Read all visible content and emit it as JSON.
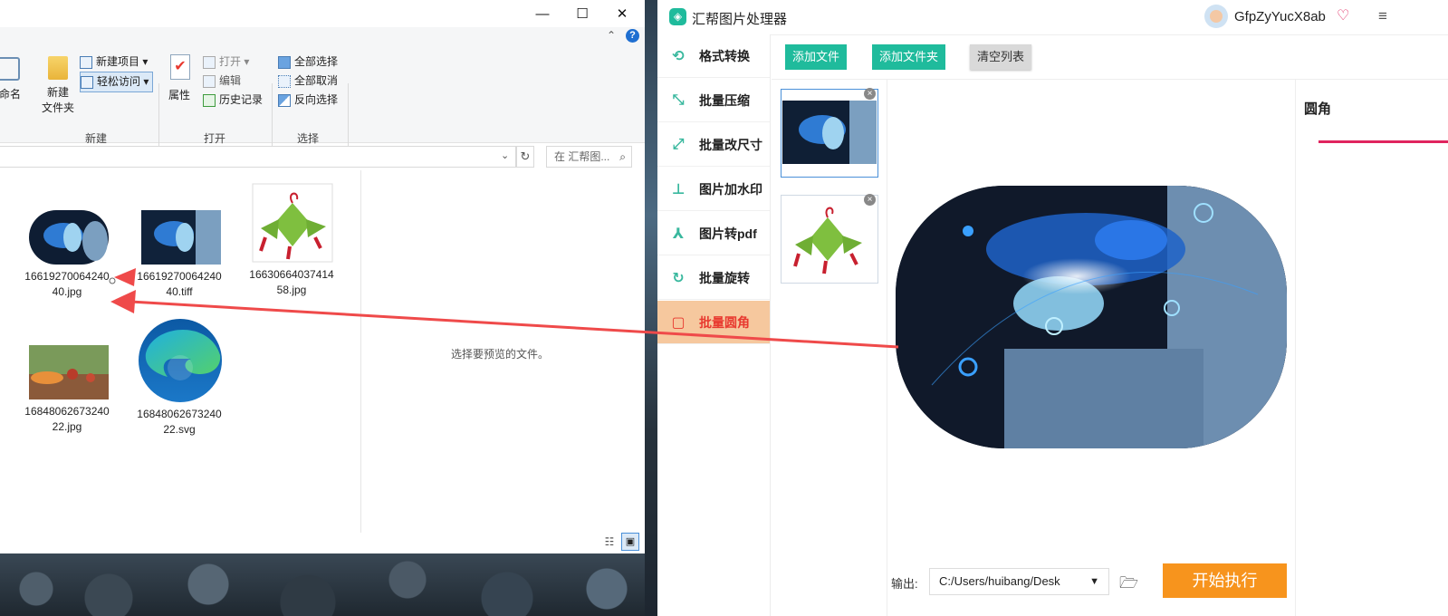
{
  "explorer": {
    "window_buttons": {
      "minimize": "—",
      "maximize": "☐",
      "close": "✕"
    },
    "ribbon": {
      "rename_partial": "重命名",
      "new_folder": "新建\n文件夹",
      "new_item": "新建项目",
      "easy_access": "轻松访问",
      "group_new": "新建",
      "properties": "属性",
      "open": "打开",
      "edit": "编辑",
      "history": "历史记录",
      "group_open": "打开",
      "select_all": "全部选择",
      "select_none": "全部取消",
      "invert_selection": "反向选择",
      "group_select": "选择"
    },
    "search_placeholder": "在 汇帮图...",
    "files": [
      {
        "name": "1661927006424040.jpg"
      },
      {
        "name": "1661927006424040.tiff"
      },
      {
        "name": "1663066403741458.jpg"
      },
      {
        "name": "1684806267324022.jpg"
      },
      {
        "name": "1684806267324022.svg"
      }
    ],
    "preview_hint": "选择要预览的文件。"
  },
  "app": {
    "title": "汇帮图片处理器",
    "username": "GfpZyYucX8ab",
    "nav": [
      {
        "label": "格式转换",
        "icon": "format-convert-icon"
      },
      {
        "label": "批量压缩",
        "icon": "compress-icon"
      },
      {
        "label": "批量改尺寸",
        "icon": "resize-icon"
      },
      {
        "label": "图片加水印",
        "icon": "watermark-icon"
      },
      {
        "label": "图片转pdf",
        "icon": "pdf-icon"
      },
      {
        "label": "批量旋转",
        "icon": "rotate-icon"
      },
      {
        "label": "批量圆角",
        "icon": "round-corner-icon",
        "active": true
      }
    ],
    "toolbar": {
      "add_file": "添加文件",
      "add_folder": "添加文件夹",
      "clear_list": "清空列表"
    },
    "settings": {
      "title": "圆角"
    },
    "output": {
      "label": "输出:",
      "path": "C:/Users/huibang/Desk"
    },
    "start_button": "开始执行",
    "colors": {
      "accent": "#1fbb9c",
      "active_nav_bg": "#f6c89e",
      "active_nav_text": "#e8392f",
      "start_btn": "#f7941d",
      "slider": "#e0245e"
    }
  }
}
